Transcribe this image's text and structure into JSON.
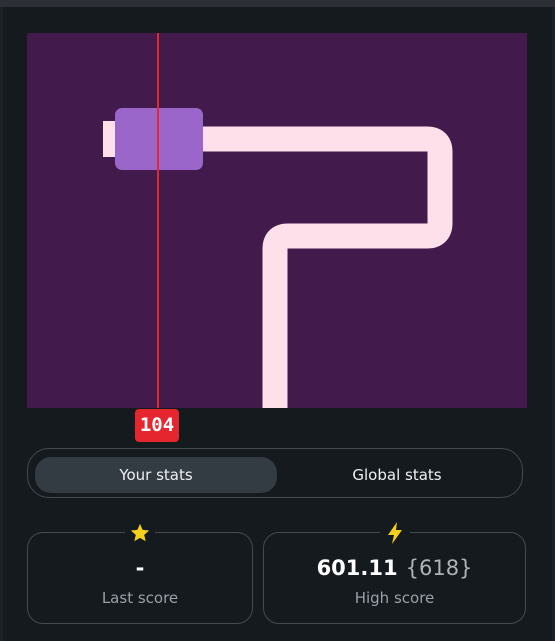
{
  "colors": {
    "board_background": "#421a4b",
    "track": "#fde0ea",
    "player_block": "#9a66c9",
    "marker_line": "#e5262e",
    "icon_yellow": "#f5cf1a"
  },
  "game": {
    "marker_value": "104"
  },
  "tabs": {
    "your_stats": "Your stats",
    "global_stats": "Global stats",
    "active": "your_stats"
  },
  "stats": {
    "last_score": {
      "icon": "star-icon",
      "value": "-",
      "label": "Last score"
    },
    "high_score": {
      "icon": "lightning-icon",
      "value": "601.11",
      "sub_value": "{618}",
      "label": "High score"
    }
  }
}
